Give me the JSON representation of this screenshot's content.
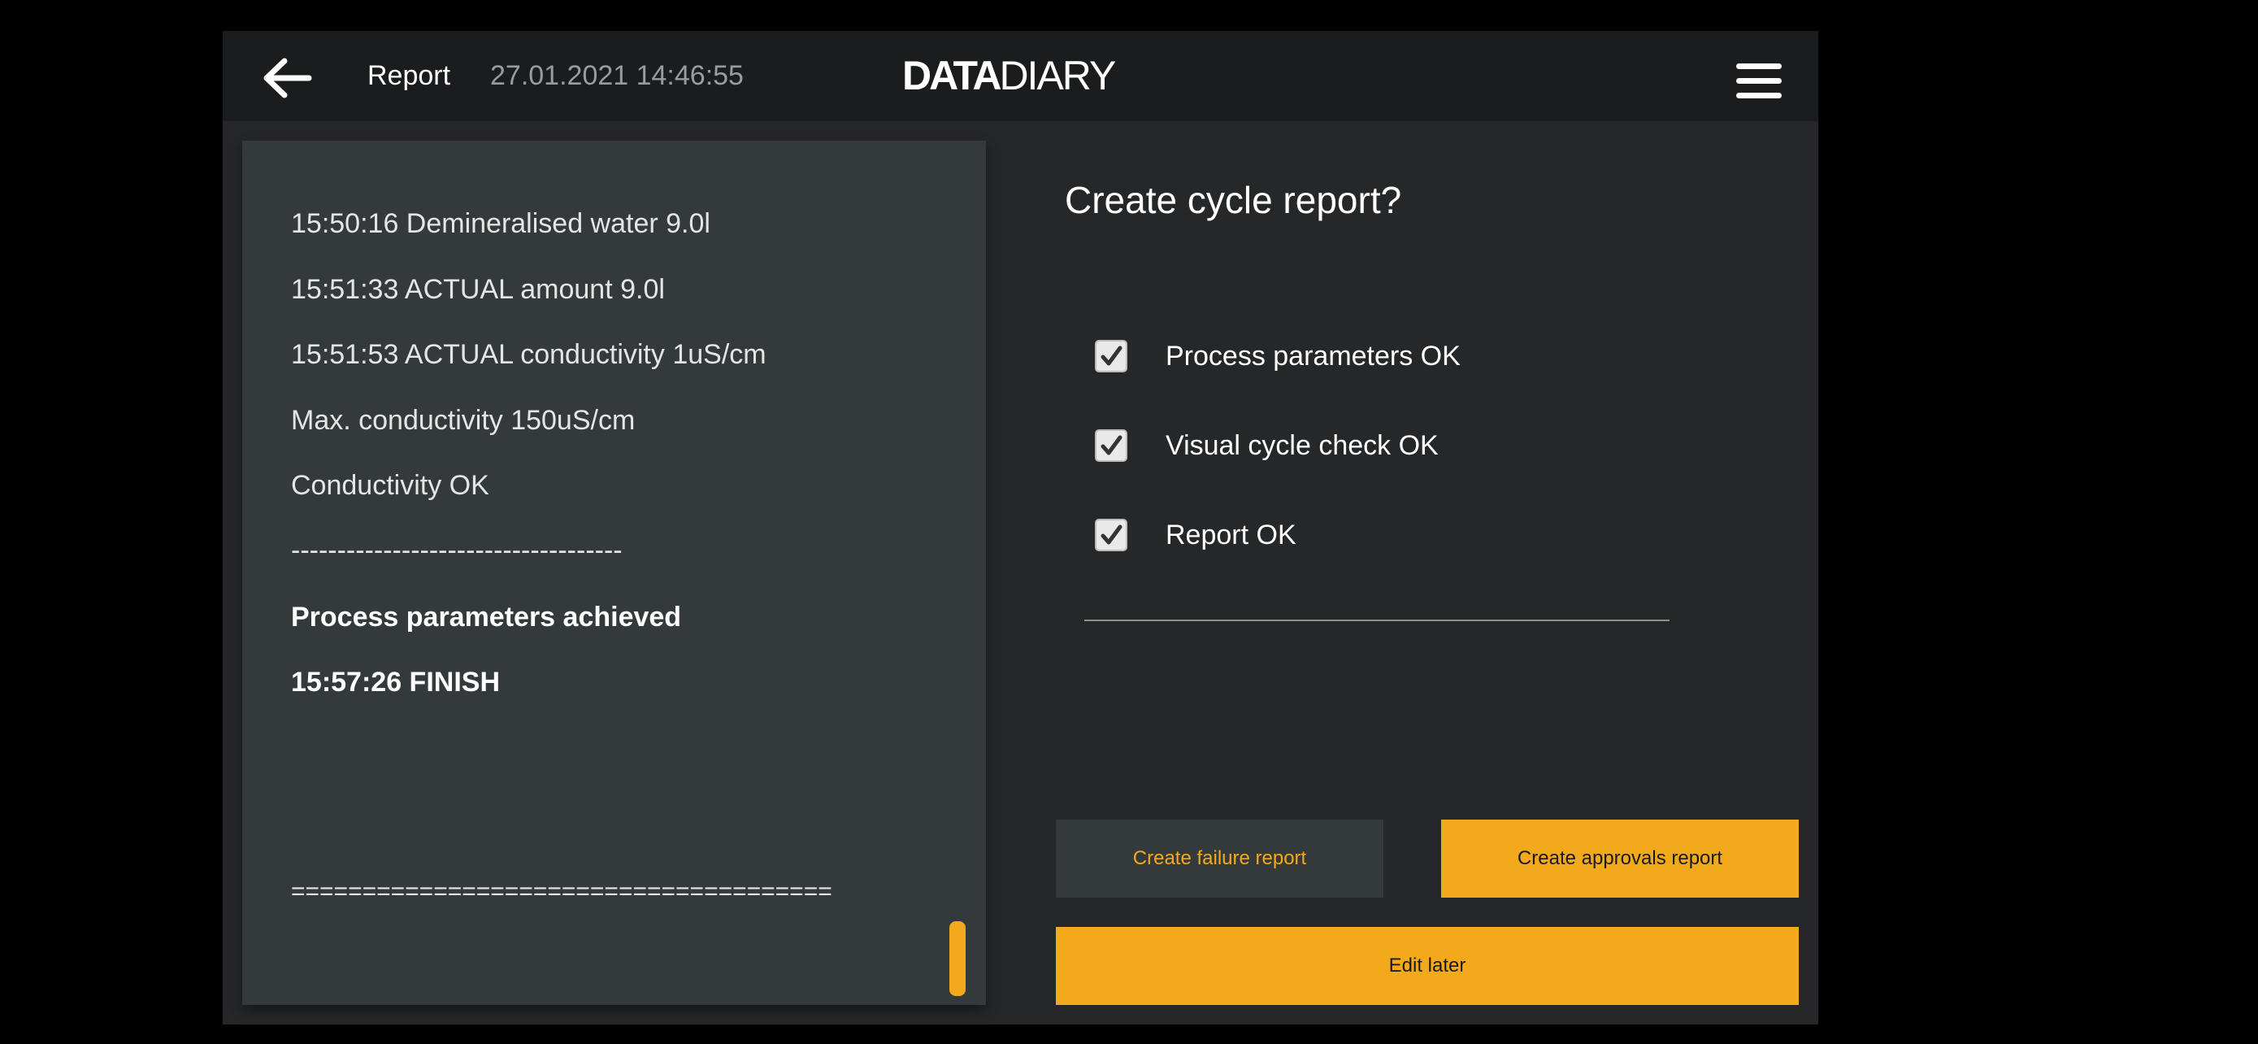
{
  "header": {
    "title": "Report",
    "datetime": "27.01.2021 14:46:55",
    "logo_bold": "DATA",
    "logo_light": "DIARY"
  },
  "report": {
    "lines": [
      "15:50:16 Demineralised water 9.0l",
      "15:51:33 ACTUAL amount 9.0l",
      "15:51:53 ACTUAL conductivity 1uS/cm",
      "Max. conductivity 150uS/cm",
      "Conductivity OK",
      "------------------------------------",
      "Process parameters achieved",
      "15:57:26 FINISH",
      "======================================"
    ]
  },
  "dialog": {
    "question": "Create cycle report?",
    "checks": [
      {
        "label": "Process parameters OK",
        "checked": true
      },
      {
        "label": "Visual cycle check OK",
        "checked": true
      },
      {
        "label": "Report OK",
        "checked": true
      }
    ]
  },
  "buttons": {
    "failure": "Create failure report",
    "approvals": "Create approvals report",
    "later": "Edit later"
  },
  "colors": {
    "accent": "#f2aa1c",
    "background": "#262729",
    "header": "#1b1c1e",
    "panel": "#343a3b"
  },
  "icons": {
    "back": "arrow-left-icon",
    "menu": "hamburger-menu-icon",
    "check": "checkmark-icon"
  }
}
